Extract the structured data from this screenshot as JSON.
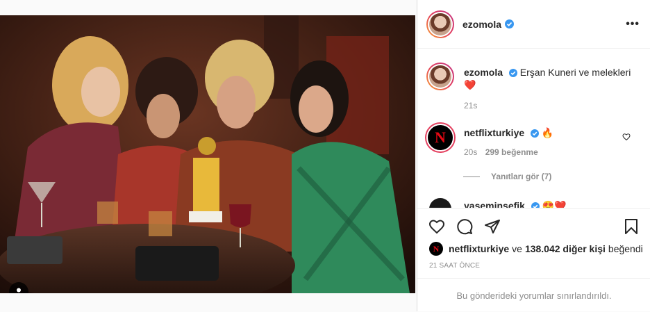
{
  "post": {
    "username": "ezomola",
    "more_label": "•••"
  },
  "caption": {
    "username": "ezomola",
    "text": "Erşan Kuneri ve melekleri",
    "emoji": "❤️",
    "age": "21s"
  },
  "comments": [
    {
      "username": "netflixturkiye",
      "emoji": "🔥",
      "age": "20s",
      "likes": "299 beğenme",
      "replies": "Yanıtları gör (7)"
    },
    {
      "username": "yaseminsefik",
      "emoji": "😍❤️"
    }
  ],
  "likes_line": {
    "user": "netflixturkiye",
    "connector": "ve",
    "others": "138.042 diğer kişi",
    "suffix": "beğendi"
  },
  "timestamp": "21 SAAT ÖNCE",
  "comments_limited": "Bu gönderideki yorumlar sınırlandırıldı.",
  "icons": {
    "like": "heart-icon",
    "comment": "comment-icon",
    "share": "share-icon",
    "save": "bookmark-icon",
    "tag": "user-tag-icon"
  },
  "colors": {
    "verified": "#3897f0",
    "netflix_red": "#e50914",
    "muted": "#8e8e8e"
  }
}
